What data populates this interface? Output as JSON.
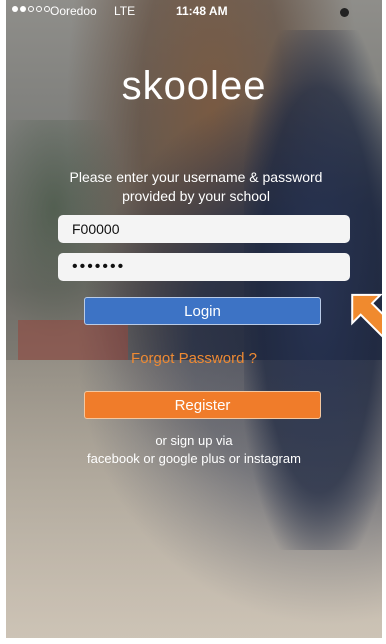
{
  "status_bar": {
    "carrier": "Ooredoo",
    "network": "LTE",
    "time": "11:48 AM"
  },
  "brand": {
    "logo_text": "skoolee"
  },
  "login_form": {
    "instructions_line1": "Please enter your username & password",
    "instructions_line2": "provided by your school",
    "username_value": "F00000",
    "password_value": "•••••••",
    "login_label": "Login",
    "forgot_label": "Forgot Password ?",
    "register_label": "Register",
    "signup_line1": "or sign up via",
    "signup_line2": "facebook or google plus or instagram"
  },
  "colors": {
    "login_button": "#3d73c5",
    "register_button": "#f07c2a",
    "forgot_text": "#ee8a33",
    "annotation_arrow": "#f08a2e"
  },
  "annotation": {
    "icon": "pointer-arrow-icon"
  }
}
